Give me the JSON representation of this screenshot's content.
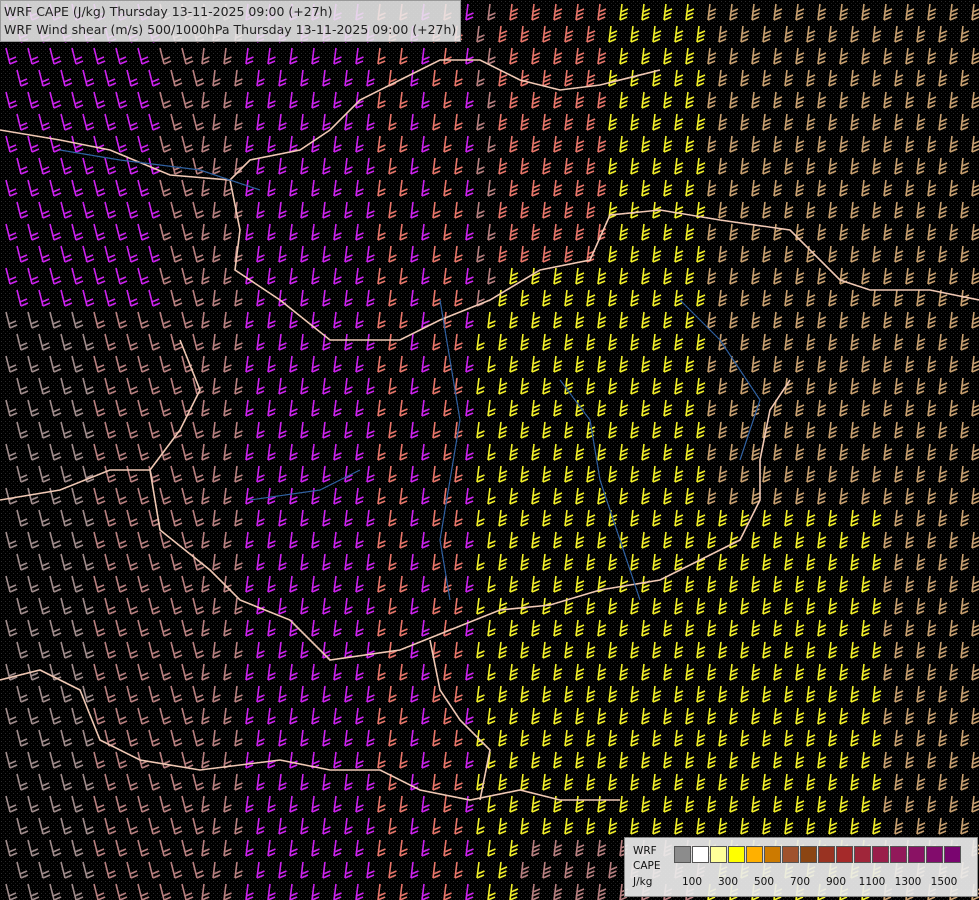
{
  "titles": {
    "line1": "WRF CAPE (J/kg) Thursday 13-11-2025 09:00 (+27h)",
    "line2": "WRF Wind shear (m/s) 500/1000hPa Thursday 13-11-2025 09:00 (+27h)"
  },
  "legend": {
    "label_top": "WRF",
    "label_mid": "CAPE",
    "label_unit": "J/kg",
    "ticks": [
      "100",
      "300",
      "500",
      "700",
      "900",
      "1100",
      "1300",
      "1500"
    ],
    "colors": [
      "#8c8c8c",
      "#ffffff",
      "#ffff99",
      "#ffff00",
      "#ffb000",
      "#cc7a00",
      "#a0522d",
      "#8b4513",
      "#993322",
      "#a52a2a",
      "#a0263a",
      "#9a1f4a",
      "#92195a",
      "#8a1264",
      "#820c6c",
      "#7a0570"
    ]
  },
  "map_style": {
    "background": "#000000",
    "barb_colors": {
      "magenta": "#cc22ee",
      "salmon": "#e8766a",
      "yellow": "#f2f02a",
      "tan": "#c8a070",
      "brownpink": "#b88080",
      "gray": "#a08c8c"
    },
    "border_color": "#f0c8b4",
    "river_color": "#3060a0"
  }
}
